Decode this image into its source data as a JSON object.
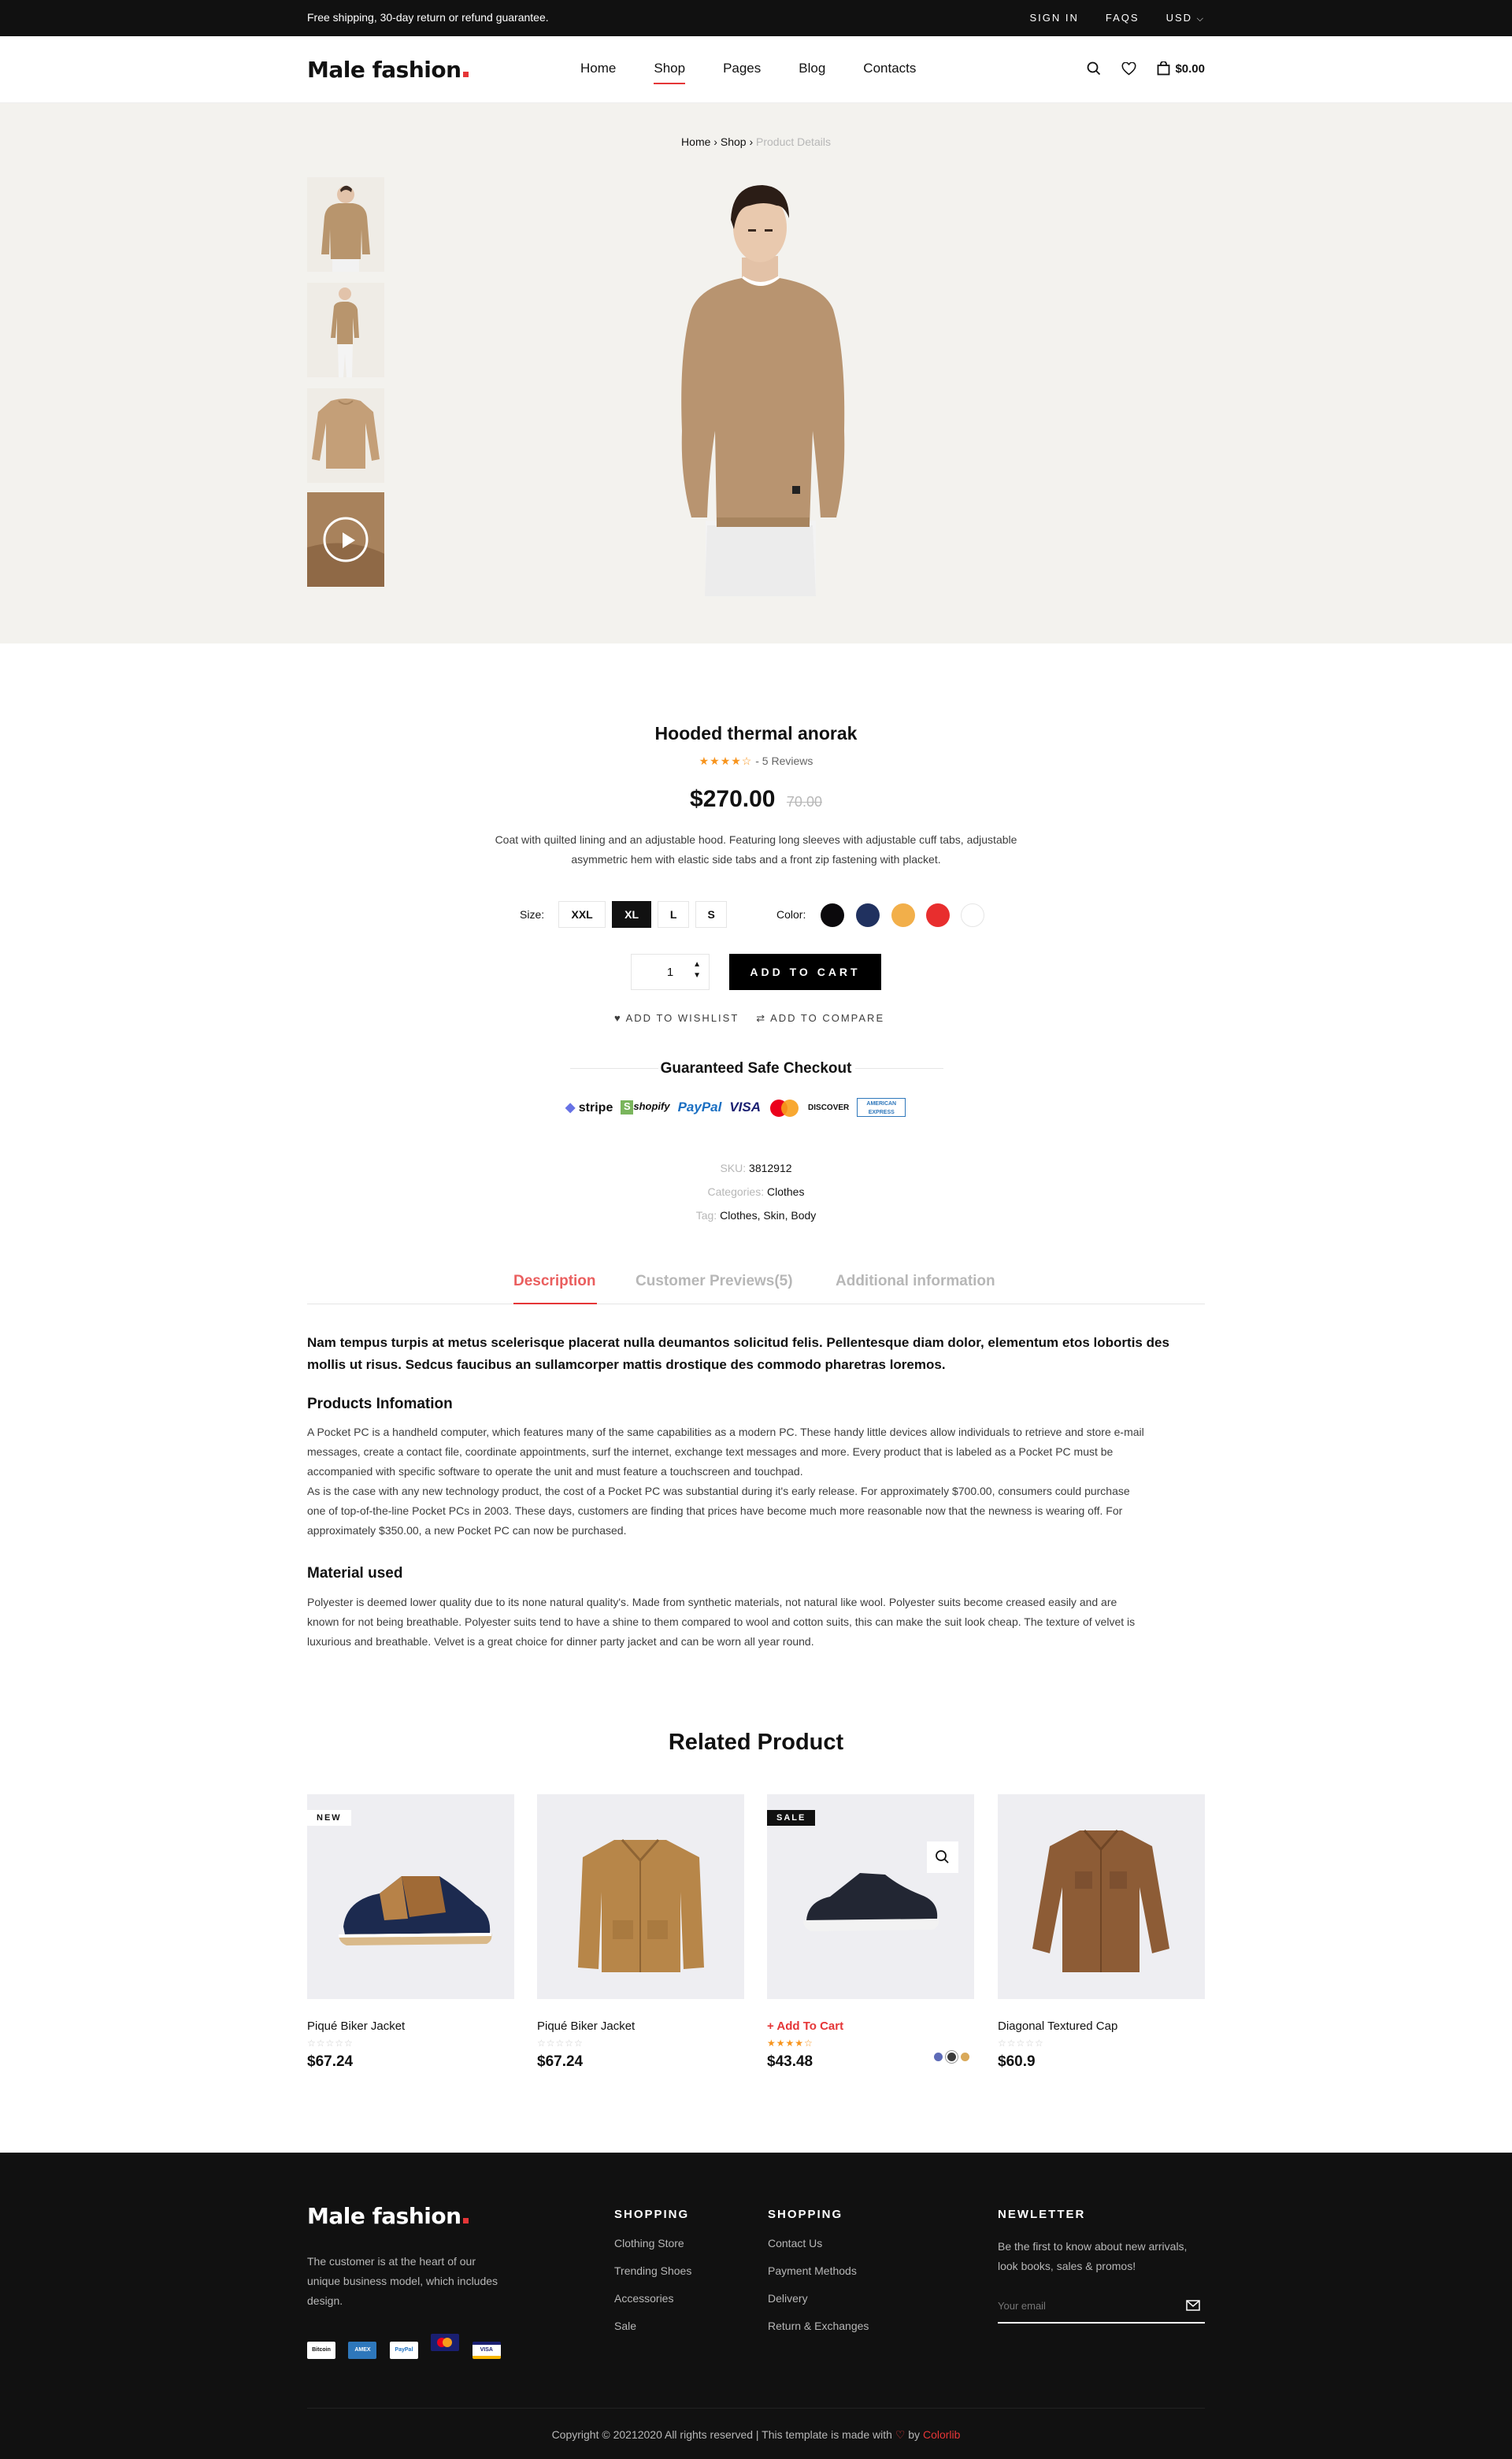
{
  "topbar": {
    "message": "Free shipping, 30-day return or refund guarantee.",
    "sign_in": "SIGN IN",
    "faqs": "FAQS",
    "currency": "USD"
  },
  "header": {
    "logo": "Male fashion",
    "nav": [
      "Home",
      "Shop",
      "Pages",
      "Blog",
      "Contacts"
    ],
    "active_nav": "Shop",
    "cart_total": "$0.00"
  },
  "breadcrumb": {
    "home": "Home",
    "shop": "Shop",
    "current": "Product Details"
  },
  "product": {
    "title": "Hooded thermal anorak",
    "rating": 4,
    "reviews": "- 5 Reviews",
    "price": "$270.00",
    "old_price": "70.00",
    "description_line1": "Coat with quilted lining and an adjustable hood. Featuring long sleeves with adjustable cuff tabs, adjustable",
    "description_line2": "asymmetric hem with elastic side tabs and a front zip fastening with placket.",
    "size_label": "Size:",
    "sizes": [
      "XXL",
      "XL",
      "L",
      "S"
    ],
    "selected_size": "XL",
    "color_label": "Color:",
    "colors": [
      "#0b090c",
      "#20315f",
      "#f2af4a",
      "#e82e2e",
      "#ffffff"
    ],
    "quantity": "1",
    "add_to_cart": "ADD TO CART",
    "wishlist": "ADD TO WISHLIST",
    "compare": "ADD TO COMPARE",
    "checkout_title": "Guaranteed Safe Checkout",
    "payment_logos": [
      "stripe",
      "shopify",
      "PayPal",
      "VISA",
      "mastercard",
      "DISCOVER",
      "AMERICAN EXPRESS"
    ],
    "sku_label": "SKU:",
    "sku": "3812912",
    "categories_label": "Categories:",
    "categories": "Clothes",
    "tag_label": "Tag:",
    "tags": "Clothes, Skin, Body"
  },
  "tabs": {
    "items": [
      "Description",
      "Customer Previews(5)",
      "Additional information"
    ],
    "active": "Description"
  },
  "description": {
    "lead_line1": "Nam tempus turpis at metus scelerisque placerat nulla deumantos solicitud felis. Pellentesque diam dolor, elementum etos lobortis des",
    "lead_line2": "mollis ut risus. Sedcus faucibus an sullamcorper mattis drostique des commodo pharetras loremos.",
    "info_title": "Products Infomation",
    "info_lines": [
      "A Pocket PC is a handheld computer, which features many of the same capabilities as a modern PC. These handy little devices allow individuals to retrieve and store e-mail",
      "messages, create a contact file, coordinate appointments, surf the internet, exchange text messages and more. Every product that is labeled as a Pocket PC must be",
      "accompanied with specific software to operate the unit and must feature a touchscreen and touchpad.",
      "As is the case with any new technology product, the cost of a Pocket PC was substantial during it's early release. For approximately $700.00, consumers could purchase",
      "one of top-of-the-line Pocket PCs in 2003. These days, customers are finding that prices have become much more reasonable now that the newness is wearing off. For",
      "approximately $350.00, a new Pocket PC can now be purchased."
    ],
    "material_title": "Material used",
    "material_lines": [
      "Polyester is deemed lower quality due to its none natural quality's. Made from synthetic materials, not natural like wool. Polyester suits become creased easily and are",
      "known for not being breathable. Polyester suits tend to have a shine to them compared to wool and cotton suits, this can make the suit look cheap. The texture of velvet is",
      "luxurious and breathable. Velvet is a great choice for dinner party jacket and can be worn all year round."
    ]
  },
  "related": {
    "title": "Related Product",
    "items": [
      {
        "name": "Piqué Biker Jacket",
        "price": "$67.24",
        "label": "NEW",
        "rating": 0
      },
      {
        "name": "Piqué Biker Jacket",
        "price": "$67.24",
        "label": "",
        "rating": 0
      },
      {
        "name": "+ Add To Cart",
        "price": "$43.48",
        "label": "SALE",
        "rating": 4
      },
      {
        "name": "Diagonal Textured Cap",
        "price": "$60.9",
        "label": "",
        "rating": 0
      }
    ],
    "swatches": [
      "#5d6bb7",
      "#3b3b3b",
      "#d9a95a"
    ]
  },
  "footer": {
    "logo": "Male fashion",
    "about_line1": "The customer is at the heart of our",
    "about_line2": "unique business model, which includes",
    "about_line3": "design.",
    "col1_title": "SHOPPING",
    "col1": [
      "Clothing Store",
      "Trending Shoes",
      "Accessories",
      "Sale"
    ],
    "col2_title": "SHOPPING",
    "col2": [
      "Contact Us",
      "Payment Methods",
      "Delivery",
      "Return & Exchanges"
    ],
    "news_title": "NEWLETTER",
    "news_line1": "Be the first to know about new arrivals,",
    "news_line2": "look books, sales & promos!",
    "email_placeholder": "Your email",
    "copyright": "Copyright © 20212020 All rights reserved | This template is made with",
    "by": "by",
    "credit": "Colorlib"
  }
}
